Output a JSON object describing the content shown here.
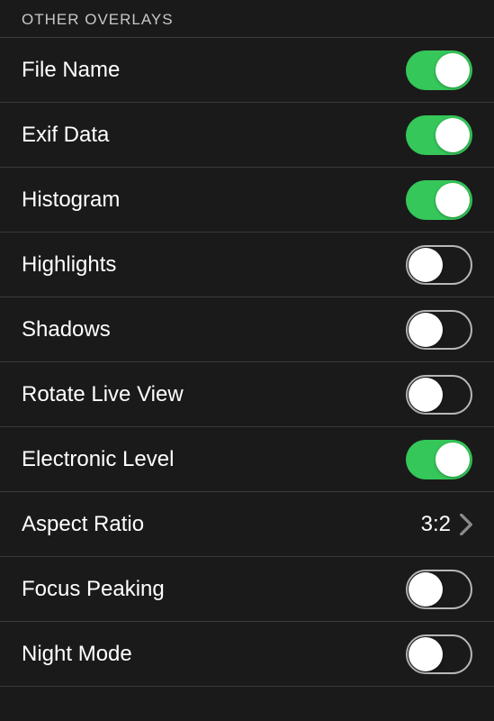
{
  "section": {
    "title": "OTHER OVERLAYS"
  },
  "rows": {
    "file_name": {
      "label": "File Name",
      "on": true
    },
    "exif_data": {
      "label": "Exif Data",
      "on": true
    },
    "histogram": {
      "label": "Histogram",
      "on": true
    },
    "highlights": {
      "label": "Highlights",
      "on": false
    },
    "shadows": {
      "label": "Shadows",
      "on": false
    },
    "rotate_live_view": {
      "label": "Rotate Live View",
      "on": false
    },
    "electronic_level": {
      "label": "Electronic Level",
      "on": true
    },
    "aspect_ratio": {
      "label": "Aspect Ratio",
      "value": "3:2"
    },
    "focus_peaking": {
      "label": "Focus Peaking",
      "on": false
    },
    "night_mode": {
      "label": "Night Mode",
      "on": false
    }
  },
  "colors": {
    "toggle_on": "#35c759",
    "background": "#1a1a1a",
    "divider": "#3a3a3a"
  }
}
